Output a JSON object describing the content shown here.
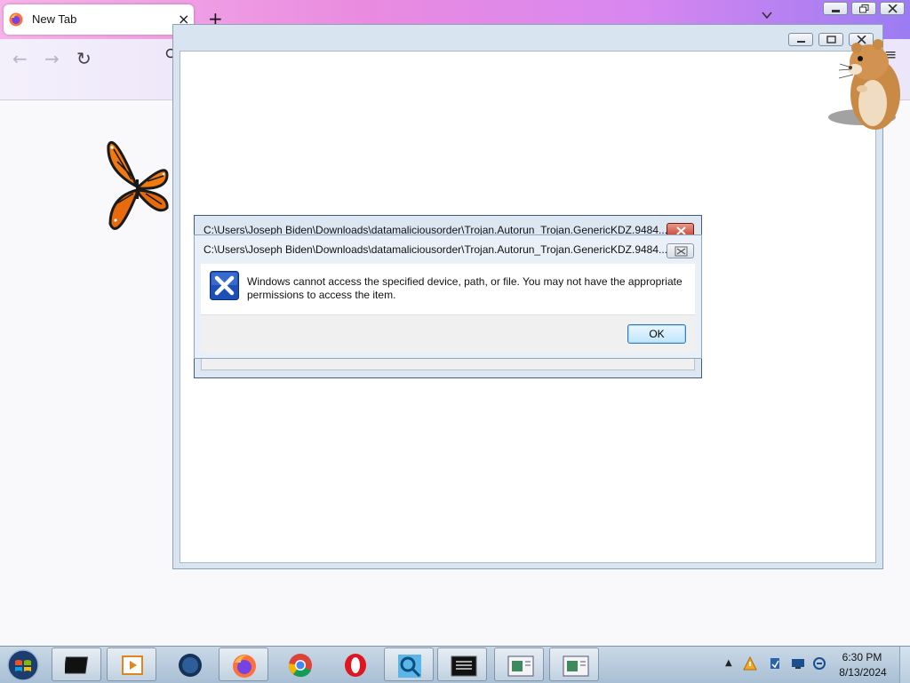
{
  "browser": {
    "tab_title": "New Tab",
    "tab_close": "×",
    "new_tab": "+",
    "back": "←",
    "forward": "→",
    "reload": "↻",
    "menu": "≡",
    "brand_colors": [
      "#f6b3e9",
      "#d887f0",
      "#9b7cf2"
    ]
  },
  "dialog_back": {
    "title": "C:\\Users\\Joseph Biden\\Downloads\\datamaliciousorder\\Trojan.Autorun_Trojan.GenericKDZ.9484..."
  },
  "dialog_front": {
    "title": "C:\\Users\\Joseph Biden\\Downloads\\datamaliciousorder\\Trojan.Autorun_Trojan.GenericKDZ.9484...",
    "message": "Windows cannot access the specified device, path, or file.  You may not have the appropriate permissions to access the item.",
    "ok_label": "OK",
    "icon": "error-x-icon"
  },
  "taskbar": {
    "items": [
      "terminal-icon",
      "media-player-icon",
      "globe-icon",
      "firefox-icon",
      "chrome-icon",
      "opera-icon",
      "search-app-icon",
      "console-icon",
      "window-app-icon",
      "window-app-icon"
    ],
    "tray": {
      "time": "6:30 PM",
      "date": "8/13/2024",
      "show_hidden": "▲"
    }
  }
}
